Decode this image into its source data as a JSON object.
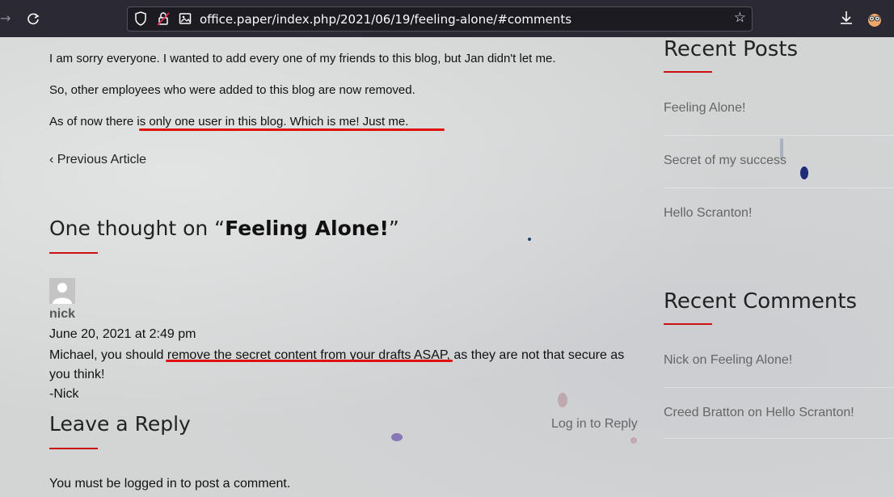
{
  "browser": {
    "url": "office.paper/index.php/2021/06/19/feeling-alone/#comments"
  },
  "post": {
    "paragraphs": [
      "I am sorry everyone. I wanted to add every one of my friends to this blog, but Jan didn't let me.",
      "So, other employees who were added to this blog are now removed.",
      "As of now there is only one user in this blog. Which is me! Just me."
    ],
    "prev_article": "‹ Previous Article"
  },
  "comments": {
    "heading_prefix": "One thought on “",
    "heading_title": "Feeling Alone!",
    "heading_suffix": "”",
    "items": [
      {
        "author": "nick",
        "date": "June 20, 2021 at 2:49 pm",
        "text_lines": [
          "Michael, you should remove the secret content from your drafts ASAP, as they are not that secure as",
          "you think!",
          "-Nick"
        ]
      }
    ]
  },
  "reply": {
    "heading": "Leave a Reply",
    "login_link": "Log in to Reply",
    "notice": "You must be logged in to post a comment."
  },
  "sidebar": {
    "recent_posts": {
      "title": "Recent Posts",
      "items": [
        "Feeling Alone!",
        "Secret of my success",
        "Hello Scranton!"
      ]
    },
    "recent_comments": {
      "title": "Recent Comments",
      "items": [
        {
          "author": "Nick",
          "on": "on",
          "post": "Feeling Alone!"
        },
        {
          "author": "Creed Bratton",
          "on": "on",
          "post": "Hello Scranton!"
        }
      ]
    }
  },
  "colors": {
    "accent": "#cc1111",
    "highlight_underline": "#e01010"
  }
}
